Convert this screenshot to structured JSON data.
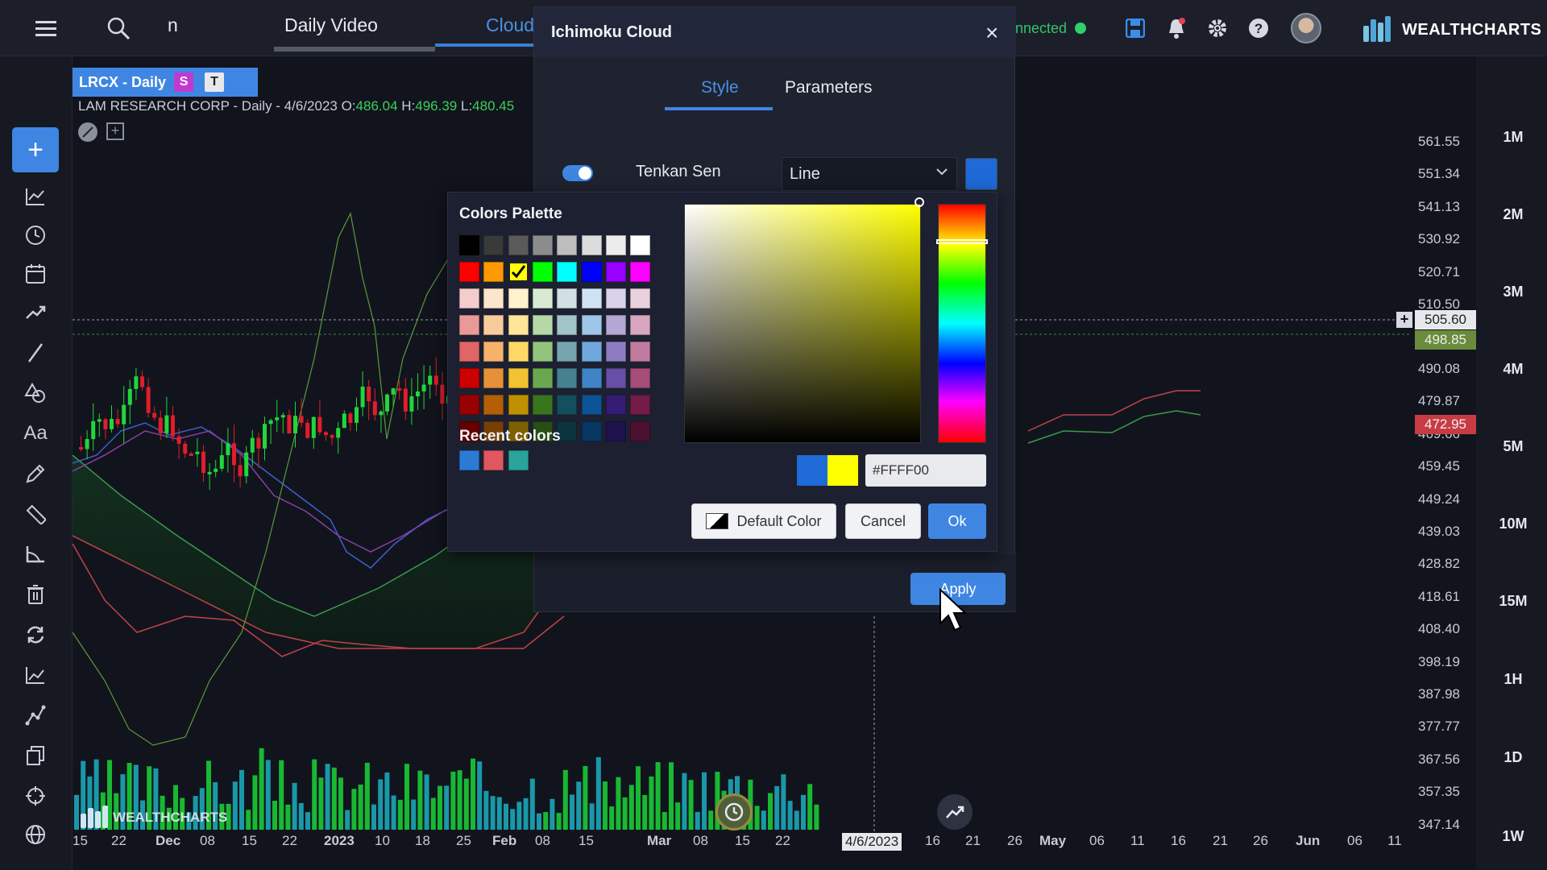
{
  "topbar": {
    "search_fragment": "n",
    "tab_daily_video": "Daily Video",
    "tab_cloud": "Cloud",
    "connected": "nnected",
    "brand": "WEALTHCHARTS"
  },
  "symbol": {
    "tag": "LRCX - Daily",
    "badge_s": "S",
    "badge_t": "T",
    "info_name": "LAM RESEARCH CORP",
    "info_rest": " - Daily - 4/6/2023 O:",
    "open": "486.04",
    "high_label": " H:",
    "high": "496.39",
    "low_label": " L:",
    "low": "480.45"
  },
  "timeframes": [
    "1M",
    "2M",
    "3M",
    "4M",
    "5M",
    "10M",
    "15M",
    "1H",
    "1D",
    "1W"
  ],
  "price_axis": [
    "561.55",
    "551.34",
    "541.13",
    "530.92",
    "520.71",
    "510.50",
    "490.08",
    "479.87",
    "469.66",
    "459.45",
    "449.24",
    "439.03",
    "428.82",
    "418.61",
    "408.40",
    "398.19",
    "387.98",
    "377.77",
    "367.56",
    "357.35",
    "347.14"
  ],
  "price_tags": {
    "current": "505.60",
    "green": "498.85",
    "red": "472.95"
  },
  "x_axis": [
    "15",
    "22",
    "Dec",
    "08",
    "15",
    "22",
    "2023",
    "10",
    "18",
    "25",
    "Feb",
    "08",
    "15",
    "Mar",
    "08",
    "15",
    "22",
    "4/6/2023",
    "16",
    "21",
    "26",
    "May",
    "06",
    "11",
    "16",
    "21",
    "26",
    "Jun",
    "06",
    "11"
  ],
  "watermark": "WEALTHCHARTS",
  "dialog": {
    "title": "Ichimoku Cloud",
    "close": "×",
    "tab_style": "Style",
    "tab_parameters": "Parameters",
    "row_label": "Tenkan Sen",
    "line_type": "Line",
    "apply": "Apply"
  },
  "colorpop": {
    "palette_title": "Colors Palette",
    "recent_title": "Recent colors",
    "hex_value": "#FFFF00",
    "default_btn": "Default Color",
    "cancel_btn": "Cancel",
    "ok_btn": "Ok",
    "palette": [
      [
        "#000000",
        "#3a3a3a",
        "#5a5a5a",
        "#8c8c8c",
        "#bdbdbd",
        "#dcdcdc",
        "#ececec",
        "#ffffff"
      ],
      [
        "#ff0000",
        "#ff9900",
        "#ffff00",
        "#00ff00",
        "#00ffff",
        "#0000ff",
        "#9900ff",
        "#ff00ff"
      ],
      [
        "#f4cccc",
        "#fce5cd",
        "#fff2cc",
        "#d9ead3",
        "#d0e0e3",
        "#cfe2f3",
        "#d9d2e9",
        "#ead1dc"
      ],
      [
        "#ea9999",
        "#f9cb9c",
        "#ffe599",
        "#b6d7a8",
        "#a2c4c9",
        "#9fc5e8",
        "#b4a7d6",
        "#d5a6bd"
      ],
      [
        "#e06666",
        "#f6b26b",
        "#ffd966",
        "#93c47d",
        "#76a5af",
        "#6fa8dc",
        "#8e7cc3",
        "#c27ba0"
      ],
      [
        "#cc0000",
        "#e69138",
        "#f1c232",
        "#6aa84f",
        "#45818e",
        "#3d85c6",
        "#674ea7",
        "#a64d79"
      ],
      [
        "#990000",
        "#b45f06",
        "#bf9000",
        "#38761d",
        "#134f5c",
        "#0b5394",
        "#351c75",
        "#741b47"
      ],
      [
        "#660000",
        "#783f04",
        "#7f6000",
        "#274e13",
        "#0c343d",
        "#073763",
        "#20124d",
        "#4c1130"
      ]
    ],
    "recent": [
      "#2d7ad6",
      "#e0575f",
      "#2aa49a"
    ],
    "selected_color": "#ffff00",
    "previous_color": "#1e6ad6"
  }
}
